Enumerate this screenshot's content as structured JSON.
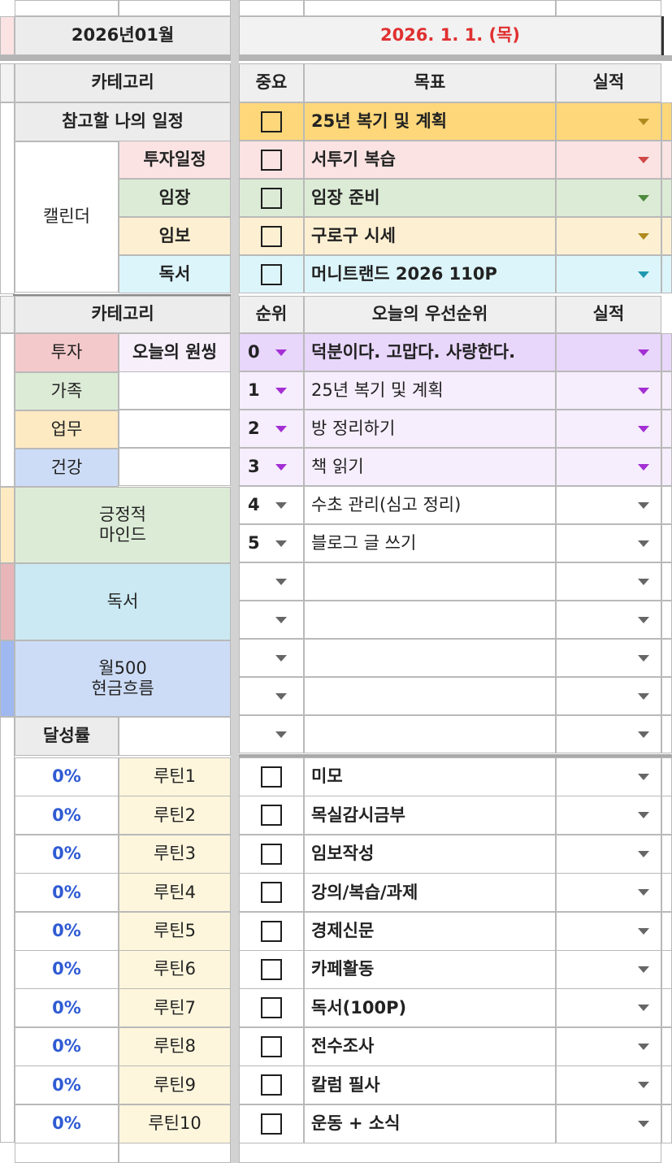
{
  "header": {
    "month_label": "2026년01월",
    "date_label": "2026. 1. 1. (목)",
    "date_color": "#e03030"
  },
  "goals": {
    "category_header": "카테고리",
    "important_header": "중요",
    "goal_header": "목표",
    "result_header": "실적",
    "reference_label": "참고할 나의 일정",
    "calendar_label": "캘린더",
    "rows": [
      {
        "category": "",
        "goal": "25년 복기 및 계획",
        "bg": "#fdd77a",
        "arrow": "#b08a1e"
      },
      {
        "category": "투자일정",
        "goal": "서투기 복습",
        "bg": "#fbe3e3",
        "arrow": "#d04848"
      },
      {
        "category": "임장",
        "goal": "임장 준비",
        "bg": "#dcebd6",
        "arrow": "#4e8a3e"
      },
      {
        "category": "임보",
        "goal": "구로구 시세",
        "bg": "#fdf0d2",
        "arrow": "#b08a1e"
      },
      {
        "category": "독서",
        "goal": "머니트랜드 2026 110P",
        "bg": "#dcf5fb",
        "arrow": "#1e98b0"
      }
    ]
  },
  "priorities": {
    "category_header": "카테고리",
    "rank_header": "순위",
    "priority_header": "오늘의 우선순위",
    "result_header": "실적",
    "today_onething": "오늘의 원씽",
    "categories": [
      {
        "label": "투자",
        "bg": "#f4c9cb"
      },
      {
        "label": "가족",
        "bg": "#dcebd6"
      },
      {
        "label": "업무",
        "bg": "#fdeac2"
      },
      {
        "label": "건강",
        "bg": "#cddcf6"
      },
      {
        "label": "긍정적\n마인드",
        "bg": "#dcebd6"
      },
      {
        "label": "독서",
        "bg": "#cbe9f2"
      },
      {
        "label": "월500\n현금흐름",
        "bg": "#cddcf6"
      }
    ],
    "achievement_label": "달성률",
    "rows": [
      {
        "rank": "0",
        "text": "덕분이다. 고맙다. 사랑한다.",
        "bold": true,
        "bg": "#e8d6fb"
      },
      {
        "rank": "1",
        "text": "25년 복기 및 계획",
        "bold": false,
        "bg": "#f6edfd"
      },
      {
        "rank": "2",
        "text": "방 정리하기",
        "bold": false,
        "bg": "#f6edfd"
      },
      {
        "rank": "3",
        "text": "책 읽기",
        "bold": false,
        "bg": "#f6edfd"
      },
      {
        "rank": "4",
        "text": "수초 관리(심고 정리)",
        "bold": false,
        "bg": "#ffffff"
      },
      {
        "rank": "5",
        "text": "블로그 글 쓰기",
        "bold": false,
        "bg": "#ffffff"
      },
      {
        "rank": "",
        "text": "",
        "bold": false,
        "bg": "#ffffff"
      },
      {
        "rank": "",
        "text": "",
        "bold": false,
        "bg": "#ffffff"
      },
      {
        "rank": "",
        "text": "",
        "bold": false,
        "bg": "#ffffff"
      },
      {
        "rank": "",
        "text": "",
        "bold": false,
        "bg": "#ffffff"
      },
      {
        "rank": "",
        "text": "",
        "bold": false,
        "bg": "#ffffff"
      }
    ]
  },
  "routines": {
    "rows": [
      {
        "percent": "0%",
        "name": "루틴1",
        "task": "미모"
      },
      {
        "percent": "0%",
        "name": "루틴2",
        "task": "목실감시금부"
      },
      {
        "percent": "0%",
        "name": "루틴3",
        "task": "임보작성"
      },
      {
        "percent": "0%",
        "name": "루틴4",
        "task": "강의/복습/과제"
      },
      {
        "percent": "0%",
        "name": "루틴5",
        "task": "경제신문"
      },
      {
        "percent": "0%",
        "name": "루틴6",
        "task": "카페활동"
      },
      {
        "percent": "0%",
        "name": "루틴7",
        "task": "독서(100P)"
      },
      {
        "percent": "0%",
        "name": "루틴8",
        "task": "전수조사"
      },
      {
        "percent": "0%",
        "name": "루틴9",
        "task": "칼럼 필사"
      },
      {
        "percent": "0%",
        "name": "루틴10",
        "task": "운동 + 소식"
      }
    ]
  },
  "colors": {
    "routine_name_bg": "#fdf6dc",
    "purple_arrow": "#a32fd3",
    "grey_arrow": "#666666",
    "percent_color": "#2f5bd3"
  }
}
